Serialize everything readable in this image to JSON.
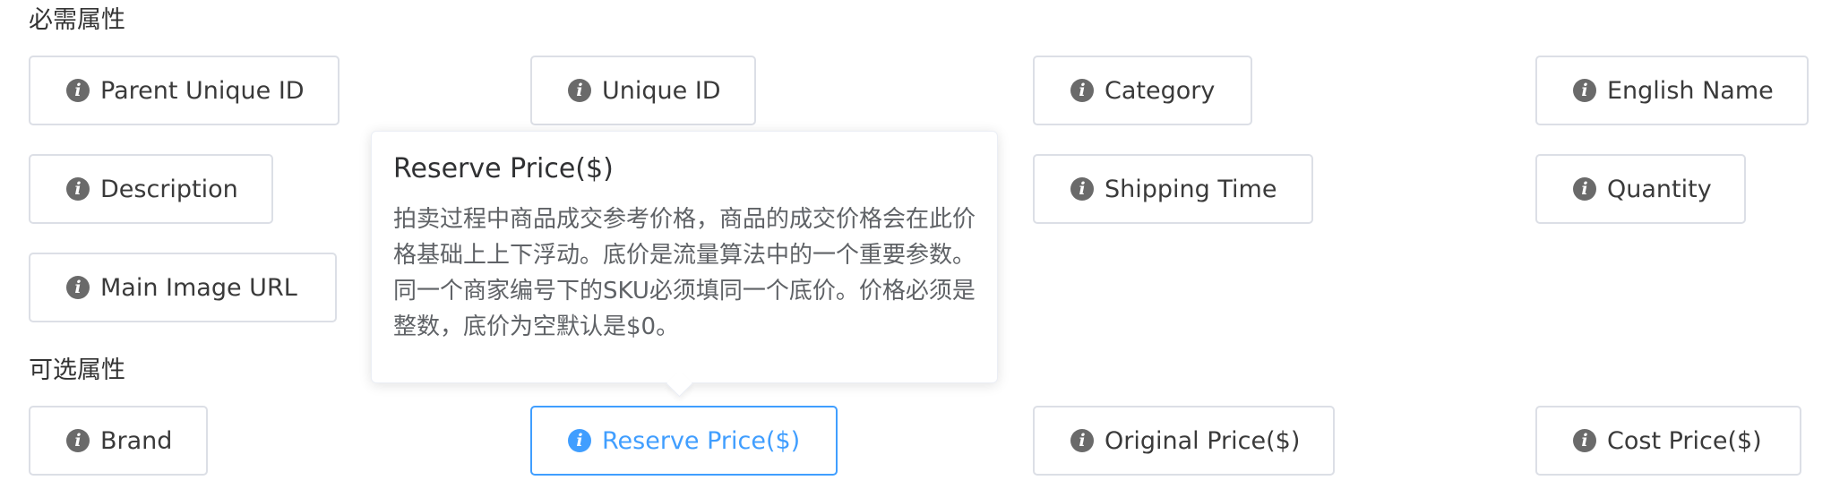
{
  "sections": {
    "required_title": "必需属性",
    "optional_title": "可选属性"
  },
  "info_glyph": "i",
  "required": [
    {
      "label": "Parent Unique ID"
    },
    {
      "label": "Unique ID"
    },
    {
      "label": "Category"
    },
    {
      "label": "English Name"
    },
    {
      "label": "Description"
    },
    {
      "label": "Shipping Time"
    },
    {
      "label": "Quantity"
    },
    {
      "label": "Main Image URL"
    }
  ],
  "optional": [
    {
      "label": "Brand"
    },
    {
      "label": "Reserve Price($)",
      "active": true
    },
    {
      "label": "Original Price($)"
    },
    {
      "label": "Cost Price($)"
    }
  ],
  "popover": {
    "title": "Reserve Price($)",
    "body": "拍卖过程中商品成交参考价格，商品的成交价格会在此价格基础上上下浮动。底价是流量算法中的一个重要参数。同一个商家编号下的SKU必须填同一个底价。价格必须是整数，底价为空默认是$0。"
  },
  "colors": {
    "active_accent": "#409eff",
    "chip_border": "#dcdfe6",
    "icon_gray": "#6a6a6a"
  }
}
